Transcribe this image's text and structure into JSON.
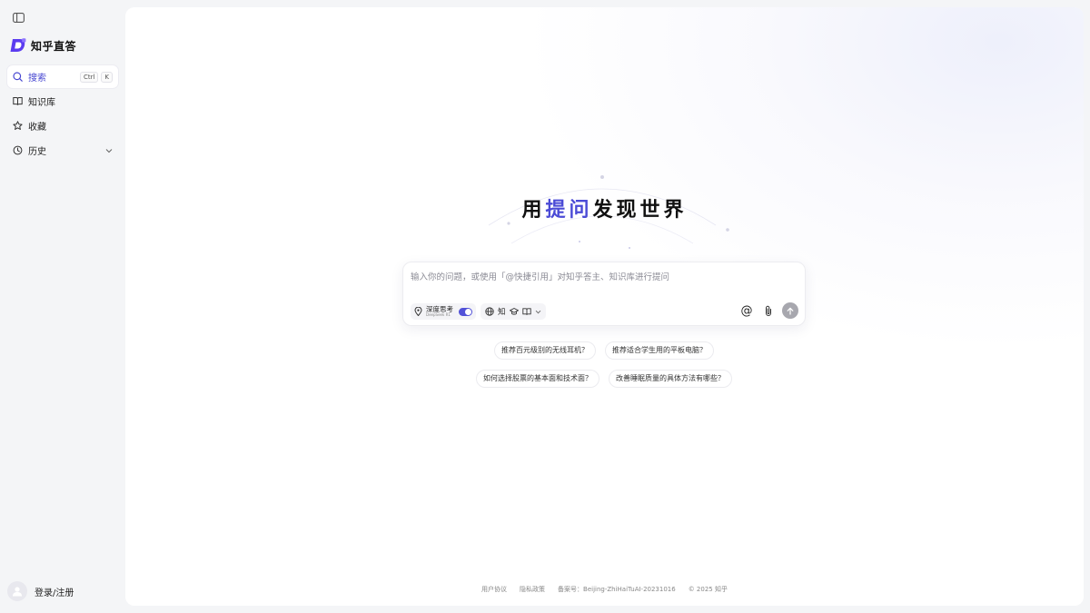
{
  "brand": {
    "name": "知乎直答",
    "color": "#5b3cf0"
  },
  "sidebar": {
    "items": [
      {
        "label": "搜索",
        "icon": "search-icon",
        "shortcut": [
          "Ctrl",
          "K"
        ],
        "active": true
      },
      {
        "label": "知识库",
        "icon": "book-icon"
      },
      {
        "label": "收藏",
        "icon": "star-icon"
      },
      {
        "label": "历史",
        "icon": "history-icon",
        "expandable": true
      }
    ],
    "login_label": "登录/注册"
  },
  "hero": {
    "prefix": "用",
    "accent": "提问",
    "suffix": "发现世界",
    "accent_color": "#4b4bd6"
  },
  "input": {
    "placeholder": "输入你的问题，或使用「@快捷引用」对知乎答主、知识库进行提问",
    "deep_think_label": "深度思考",
    "deep_think_sub": "DeepSeek R1",
    "deep_think_on": true,
    "source_label": "知"
  },
  "suggestions": [
    "推荐百元级别的无线耳机？",
    "推荐适合学生用的平板电脑？",
    "如何选择股票的基本面和技术面？",
    "改善睡眠质量的具体方法有哪些？"
  ],
  "footer": {
    "terms": "用户协议",
    "privacy": "隐私政策",
    "record": "备案号：Beijing-ZhiHaiTuAI-20231016",
    "copyright": "© 2025 知乎"
  }
}
